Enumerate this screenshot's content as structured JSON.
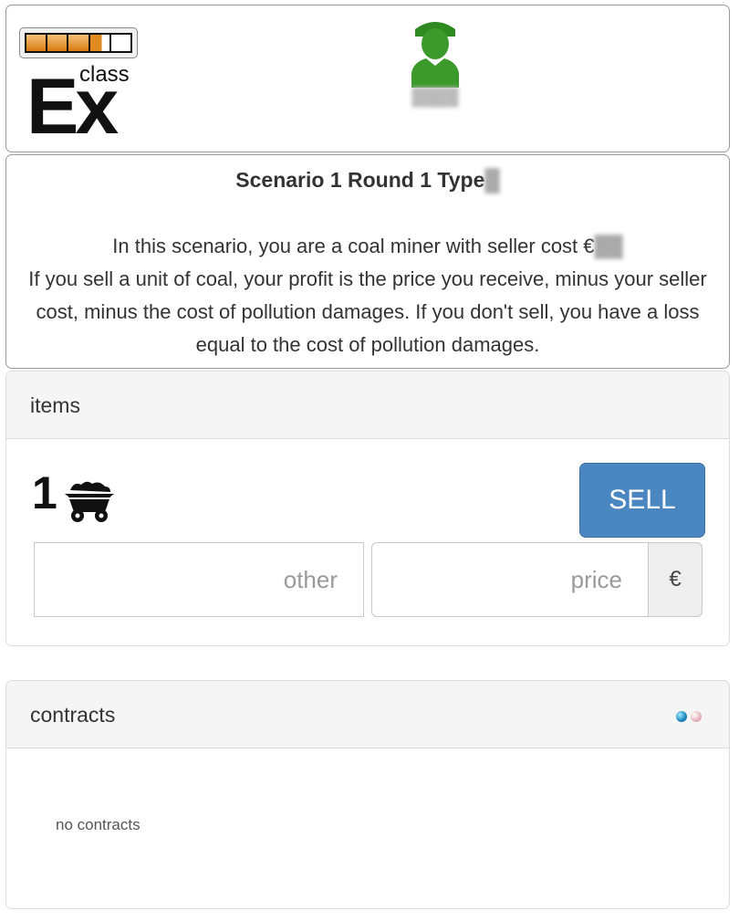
{
  "header": {
    "logo_small": "class",
    "logo_big": "Ex",
    "username": "████"
  },
  "scenario": {
    "title": "Scenario 1 Round 1 Type",
    "type_value": "█",
    "line1": "In this scenario, you are a coal miner with seller cost €",
    "seller_cost": "██",
    "line2": "If you sell a unit of coal, your profit is the price you receive, minus your seller cost, minus the cost of pollution damages. If you don't sell, you have a loss equal to the cost of pollution damages."
  },
  "items": {
    "heading": "items",
    "quantity": "1",
    "sell_label": "SELL",
    "other_placeholder": "other",
    "price_placeholder": "price",
    "currency": "€"
  },
  "contracts": {
    "heading": "contracts",
    "empty_text": "no contracts"
  },
  "colors": {
    "sell_button": "#4a86c0",
    "avatar": "#3c9a2c",
    "meter_fill": "#e08a20"
  },
  "icons": {
    "avatar": "user-icon",
    "coal": "coal-cart-icon",
    "status_dots": [
      "blue-status-dot-icon",
      "pink-status-dot-icon"
    ]
  },
  "meter": {
    "segments": 5,
    "filled": 3.6
  }
}
